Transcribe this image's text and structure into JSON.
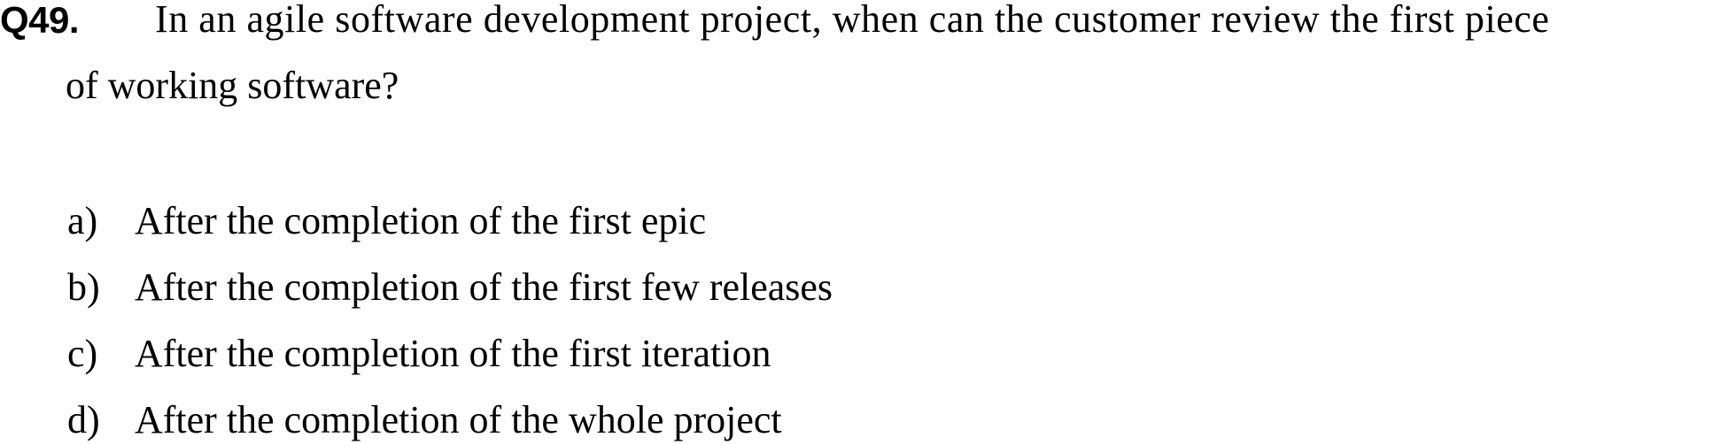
{
  "question": {
    "number": "Q49.",
    "text_line_1": "In an agile software development project, when can the customer review the first piece",
    "text_line_2": "of working software?"
  },
  "options": [
    {
      "letter": "a)",
      "text": "After the completion of the first epic"
    },
    {
      "letter": "b)",
      "text": "After the completion of the first few releases"
    },
    {
      "letter": "c)",
      "text": "After the completion of the first iteration"
    },
    {
      "letter": "d)",
      "text": "After the completion of the whole project"
    }
  ]
}
